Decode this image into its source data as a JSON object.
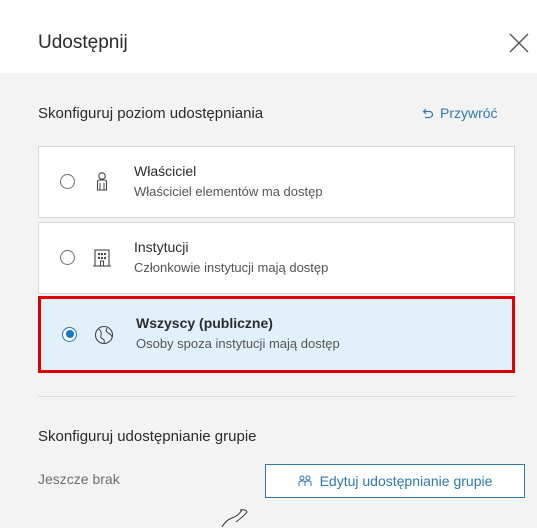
{
  "dialog": {
    "title": "Udostępnij"
  },
  "share_level": {
    "heading": "Skonfiguruj poziom udostępniania",
    "reset_label": "Przywróć",
    "options": [
      {
        "title": "Właściciel",
        "description": "Właściciel elementów ma dostęp",
        "icon": "person-icon",
        "selected": false
      },
      {
        "title": "Instytucji",
        "description": "Członkowie instytucji mają dostęp",
        "icon": "building-icon",
        "selected": false
      },
      {
        "title": "Wszyscy (publiczne)",
        "description": "Osoby spoza instytucji mają dostęp",
        "icon": "globe-icon",
        "selected": true
      }
    ]
  },
  "group_sharing": {
    "heading": "Skonfiguruj udostępnianie grupie",
    "empty_text": "Jeszcze brak",
    "edit_button_label": "Edytuj udostępnianie grupie"
  },
  "colors": {
    "accent": "#1677d2",
    "link": "#2b7ab3",
    "selected_background": "#e2f0fb",
    "highlight_border": "#e00000",
    "body_background": "#f3f3f3"
  }
}
